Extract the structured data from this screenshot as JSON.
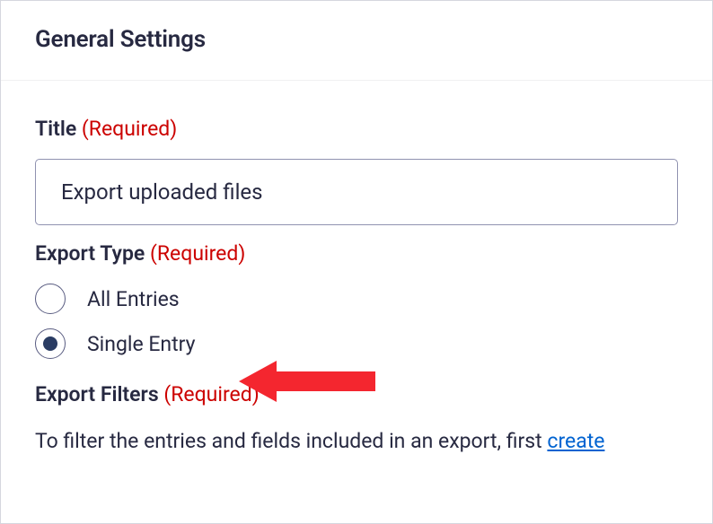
{
  "header": {
    "title": "General Settings"
  },
  "title_field": {
    "label": "Title",
    "required_text": "(Required)",
    "value": "Export uploaded files"
  },
  "export_type": {
    "label": "Export Type",
    "required_text": "(Required)",
    "options": [
      {
        "label": "All Entries",
        "selected": false
      },
      {
        "label": "Single Entry",
        "selected": true
      }
    ]
  },
  "export_filters": {
    "label": "Export Filters",
    "required_text": "(Required)",
    "description_prefix": "To filter the entries and fields included in an export, first ",
    "link_text": "create"
  }
}
